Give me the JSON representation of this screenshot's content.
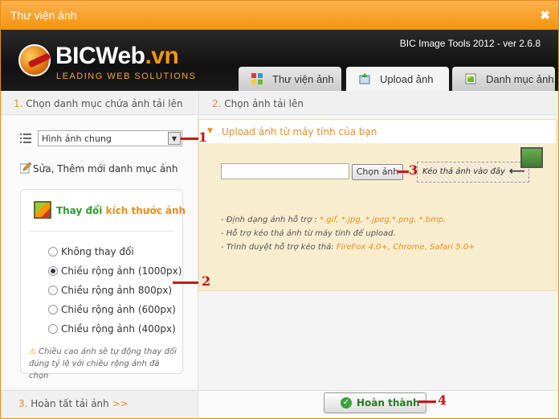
{
  "window": {
    "title": "Thư viện ảnh",
    "close_glyph": "✖"
  },
  "header": {
    "brand_main": "BICWeb",
    "brand_suffix": ".vn",
    "tagline": "LEADING WEB SOLUTIONS",
    "version": "BIC Image Tools 2012 - ver 2.6.8",
    "tabs": [
      {
        "label": "Thư viện ảnh",
        "icon": "gallery-icon",
        "active": false
      },
      {
        "label": "Upload ảnh",
        "icon": "upload-icon",
        "active": true
      },
      {
        "label": "Danh mục ảnh",
        "icon": "category-icon",
        "active": false
      }
    ]
  },
  "step1": {
    "num": "1.",
    "text": "Chọn danh mục chứa ảnh tải lên"
  },
  "step2": {
    "num": "2.",
    "text": "Chọn ảnh tải lên"
  },
  "step3": {
    "num": "3.",
    "text": "Hoàn tất tải ảnh",
    "arrow": ">>"
  },
  "category": {
    "selected": "Hình ảnh chung",
    "edit_label": "Sửa, Thêm mới danh mục ảnh"
  },
  "resize": {
    "title_a": "Thay đổi",
    "title_b": "kích thước ảnh",
    "options": [
      {
        "label": "Không thay đổi",
        "checked": false
      },
      {
        "label": "Chiều rộng ảnh (1000px)",
        "checked": true
      },
      {
        "label": "Chiều rộng ảnh 800px)",
        "checked": false
      },
      {
        "label": "Chiều rộng ảnh (600px)",
        "checked": false
      },
      {
        "label": "Chiều rộng ảnh (400px)",
        "checked": false
      }
    ],
    "note": "Chiều cao ảnh sẽ tự động thay đổi đúng tỷ lệ với chiều rộng ảnh đã chọn"
  },
  "upload": {
    "header": "Upload ảnh từ máy tính của bạn",
    "choose_button": "Chọn ảnh",
    "dropzone_text": "Kéo thả ảnh vào đây",
    "info_1_prefix": "- Định dạng ảnh hỗ trợ : ",
    "info_1_formats": "*.gif, *.jpg, *.jpeg,*.png, *.bmp.",
    "info_2": "- Hỗ trợ kéo thả ảnh từ máy tính để upload.",
    "info_3_prefix": "- Trình duyệt hỗ trợ kéo thả: ",
    "info_3_browsers": "FireFox 4.0+, Chrome, Safari 5.0+"
  },
  "finish_button": "Hoàn thành",
  "annotations": [
    "1",
    "2",
    "3",
    "4"
  ],
  "watermark_text": "BICWeb.vn",
  "colors": {
    "accent": "#f39512",
    "green": "#339933",
    "annotation": "#d01515"
  }
}
